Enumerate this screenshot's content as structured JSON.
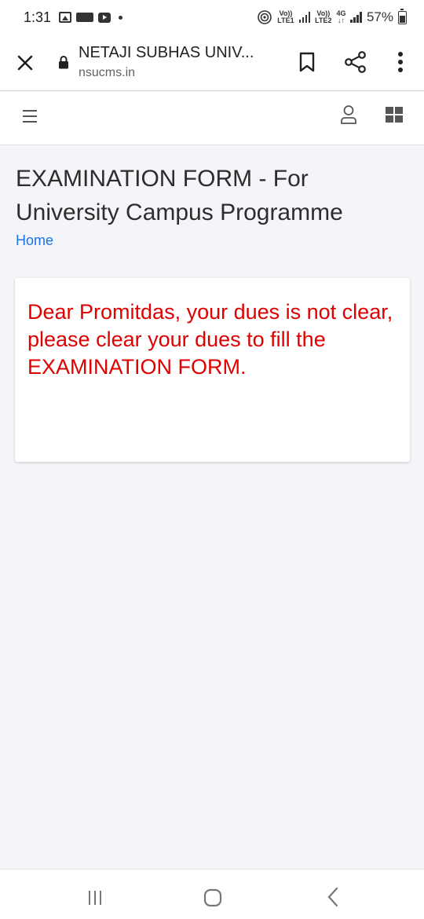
{
  "status_bar": {
    "time": "1:31",
    "net_sim1_top": "Vo))",
    "net_sim1_bottom": "LTE1",
    "net_sim2_top": "Vo))",
    "net_sim2_bottom": "LTE2",
    "net_type": "4G",
    "battery_percent": "57%",
    "icons": [
      "gallery-icon",
      "notification-box-icon",
      "youtube-icon",
      "dot-icon",
      "hotspot-icon",
      "signal-icon",
      "battery-icon"
    ]
  },
  "browser": {
    "title": "NETAJI SUBHAS UNIV...",
    "url": "nsucms.in"
  },
  "page": {
    "title": "EXAMINATION FORM - For University Campus Programme",
    "breadcrumb": "Home",
    "notice": "Dear Promitdas, your dues is not clear, please clear your dues to fill the EXAMINATION FORM."
  },
  "colors": {
    "accent_link": "#1a73e8",
    "notice_red": "#e00000",
    "background": "#f4f5f9"
  }
}
